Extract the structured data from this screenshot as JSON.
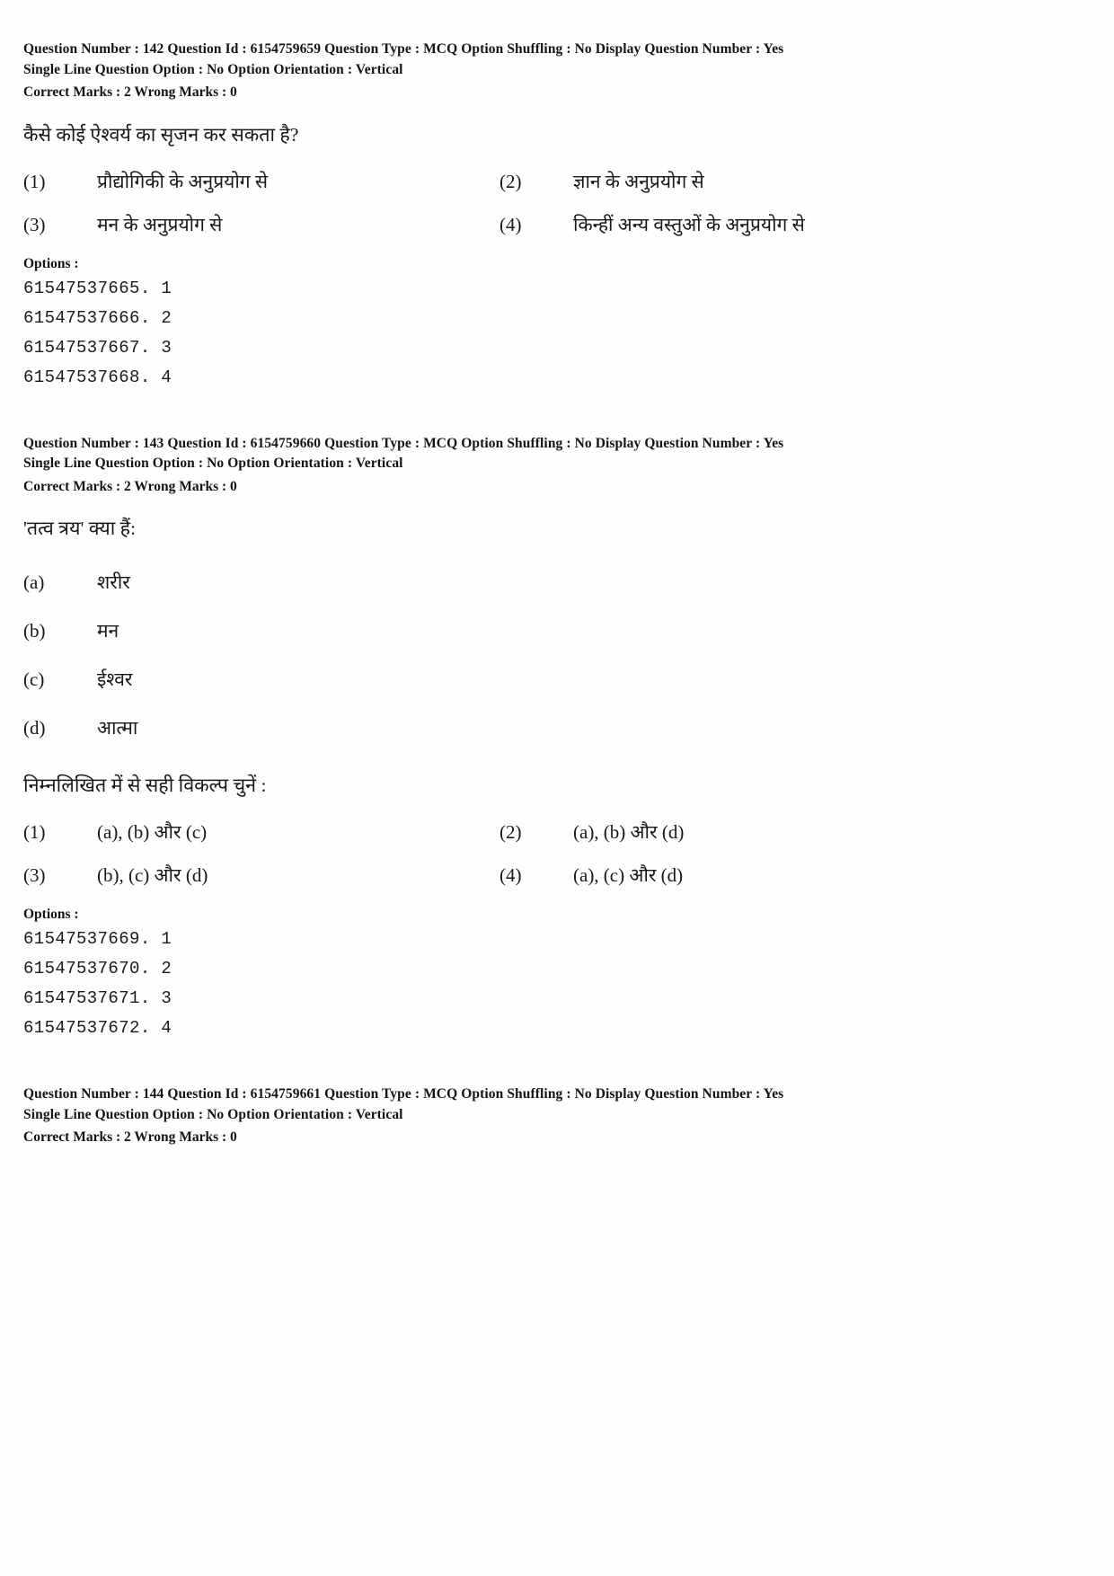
{
  "document": {
    "type": "exam-question-paper",
    "language": "Hindi"
  },
  "questions": [
    {
      "meta": {
        "line1": "Question Number : 142  Question Id : 6154759659  Question Type : MCQ  Option Shuffling : No  Display Question Number : Yes",
        "line2": "Single Line Question Option : No  Option Orientation : Vertical",
        "marks": "Correct Marks : 2  Wrong Marks : 0"
      },
      "question_text": "कैसे कोई ऐश्वर्य का सृजन कर सकता है?",
      "choices": [
        {
          "num": "(1)",
          "text": "प्रौद्योगिकी के अनुप्रयोग से"
        },
        {
          "num": "(2)",
          "text": "ज्ञान के अनुप्रयोग से"
        },
        {
          "num": "(3)",
          "text": "मन के अनुप्रयोग से"
        },
        {
          "num": "(4)",
          "text": "किन्हीं अन्य वस्तुओं के अनुप्रयोग से"
        }
      ],
      "options_label": "Options :",
      "option_ids": [
        "61547537665. 1",
        "61547537666. 2",
        "61547537667. 3",
        "61547537668. 4"
      ]
    },
    {
      "meta": {
        "line1": "Question Number : 143  Question Id : 6154759660  Question Type : MCQ  Option Shuffling : No  Display Question Number : Yes",
        "line2": "Single Line Question Option : No  Option Orientation : Vertical",
        "marks": "Correct Marks : 2  Wrong Marks : 0"
      },
      "question_text": "'तत्व त्रय' क्या हैं:",
      "sub_items": [
        {
          "letter": "(a)",
          "text": "शरीर"
        },
        {
          "letter": "(b)",
          "text": "मन"
        },
        {
          "letter": "(c)",
          "text": "ईश्वर"
        },
        {
          "letter": "(d)",
          "text": "आत्मा"
        }
      ],
      "choose_line": "निम्नलिखित में से सही विकल्प चुनें :",
      "choices": [
        {
          "num": "(1)",
          "text": "(a), (b) और (c)"
        },
        {
          "num": "(2)",
          "text": "(a), (b) और (d)"
        },
        {
          "num": "(3)",
          "text": "(b), (c) और (d)"
        },
        {
          "num": "(4)",
          "text": "(a), (c) और (d)"
        }
      ],
      "options_label": "Options :",
      "option_ids": [
        "61547537669. 1",
        "61547537670. 2",
        "61547537671. 3",
        "61547537672. 4"
      ]
    },
    {
      "meta": {
        "line1": "Question Number : 144  Question Id : 6154759661  Question Type : MCQ  Option Shuffling : No  Display Question Number : Yes",
        "line2": "Single Line Question Option : No  Option Orientation : Vertical",
        "marks": "Correct Marks : 2  Wrong Marks : 0"
      }
    }
  ]
}
